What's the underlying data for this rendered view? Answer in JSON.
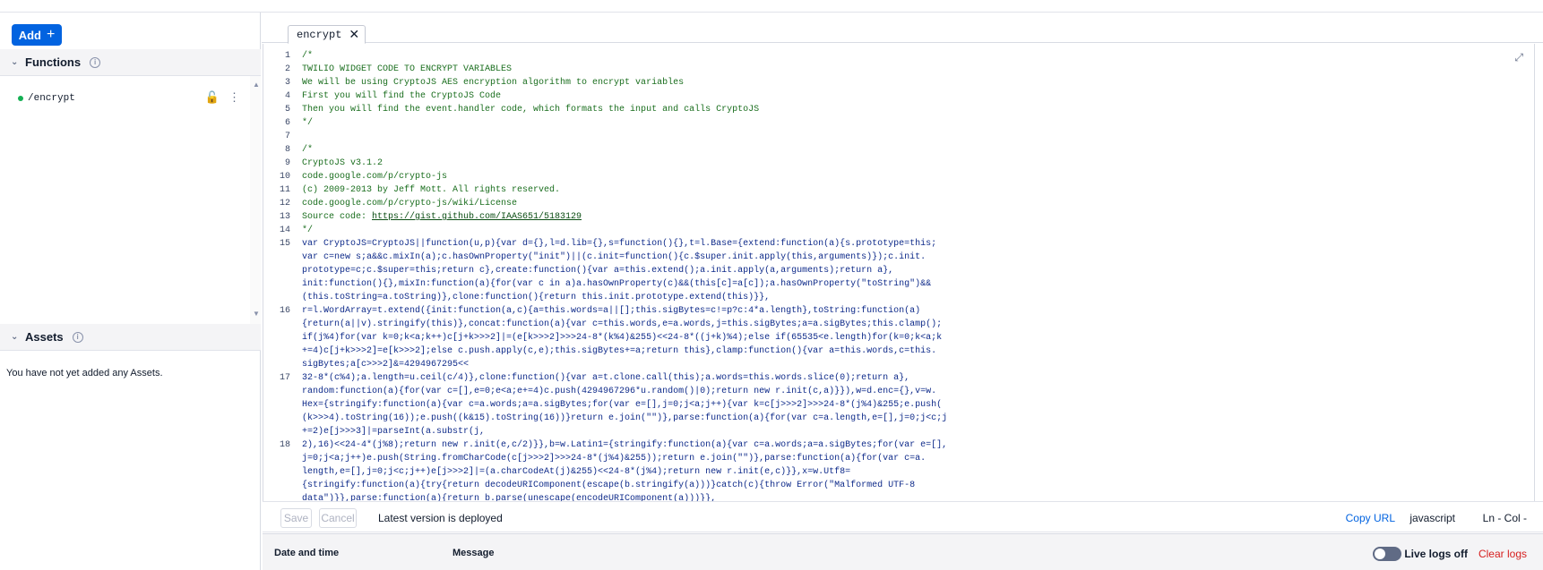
{
  "sidebar": {
    "add_label": "Add",
    "add_icon": "plus-icon",
    "functions": {
      "title": "Functions",
      "items": [
        {
          "path": "/encrypt",
          "status_color": "#14b053"
        }
      ]
    },
    "assets": {
      "title": "Assets",
      "empty_text": "You have not yet added any Assets."
    }
  },
  "editor": {
    "tab_label": "encrypt",
    "lines": [
      {
        "n": "1",
        "kind": "comment",
        "segs": [
          "/*"
        ]
      },
      {
        "n": "2",
        "kind": "comment",
        "segs": [
          "TWILIO WIDGET CODE TO ENCRYPT VARIABLES"
        ]
      },
      {
        "n": "3",
        "kind": "comment",
        "segs": [
          "We will be using CryptoJS AES encryption algorithm to encrypt variables"
        ]
      },
      {
        "n": "4",
        "kind": "comment",
        "segs": [
          "First you will find the CryptoJS Code"
        ]
      },
      {
        "n": "5",
        "kind": "comment",
        "segs": [
          "Then you will find the event.handler code, which formats the input and calls CryptoJS"
        ]
      },
      {
        "n": "6",
        "kind": "comment",
        "segs": [
          "*/"
        ]
      },
      {
        "n": "7",
        "kind": "comment",
        "segs": [
          " "
        ]
      },
      {
        "n": "8",
        "kind": "comment",
        "segs": [
          "/*"
        ]
      },
      {
        "n": "9",
        "kind": "comment",
        "segs": [
          "CryptoJS v3.1.2"
        ]
      },
      {
        "n": "10",
        "kind": "comment",
        "segs": [
          "code.google.com/p/crypto-js"
        ]
      },
      {
        "n": "11",
        "kind": "comment",
        "segs": [
          "(c) 2009-2013 by Jeff Mott. All rights reserved."
        ]
      },
      {
        "n": "12",
        "kind": "comment",
        "segs": [
          "code.google.com/p/crypto-js/wiki/License"
        ]
      },
      {
        "n": "13",
        "kind": "source",
        "segs": [
          "Source code: "
        ],
        "link": "https://gist.github.com/IAAS651/5183129"
      },
      {
        "n": "14",
        "kind": "comment",
        "segs": [
          "*/"
        ]
      },
      {
        "n": "15",
        "kind": "code",
        "segs": [
          "var CryptoJS=CryptoJS||function(u,p){var d={},l=d.lib={},s=function(){},t=l.Base={extend:function(a){s.prototype=this;",
          "var c=new s;a&&c.mixIn(a);c.hasOwnProperty(\"init\")||(c.init=function(){c.$super.init.apply(this,arguments)});c.init.",
          "prototype=c;c.$super=this;return c},create:function(){var a=this.extend();a.init.apply(a,arguments);return a},",
          "init:function(){},mixIn:function(a){for(var c in a)a.hasOwnProperty(c)&&(this[c]=a[c]);a.hasOwnProperty(\"toString\")&&",
          "(this.toString=a.toString)},clone:function(){return this.init.prototype.extend(this)}},"
        ]
      },
      {
        "n": "16",
        "kind": "code",
        "segs": [
          "r=l.WordArray=t.extend({init:function(a,c){a=this.words=a||[];this.sigBytes=c!=p?c:4*a.length},toString:function(a)",
          "{return(a||v).stringify(this)},concat:function(a){var c=this.words,e=a.words,j=this.sigBytes;a=a.sigBytes;this.clamp();",
          "if(j%4)for(var k=0;k<a;k++)c[j+k>>>2]|=(e[k>>>2]>>>24-8*(k%4)&255)<<24-8*((j+k)%4);else if(65535<e.length)for(k=0;k<a;k",
          "+=4)c[j+k>>>2]=e[k>>>2];else c.push.apply(c,e);this.sigBytes+=a;return this},clamp:function(){var a=this.words,c=this.",
          "sigBytes;a[c>>>2]&=4294967295<<"
        ]
      },
      {
        "n": "17",
        "kind": "code",
        "segs": [
          "32-8*(c%4);a.length=u.ceil(c/4)},clone:function(){var a=t.clone.call(this);a.words=this.words.slice(0);return a},",
          "random:function(a){for(var c=[],e=0;e<a;e+=4)c.push(4294967296*u.random()|0);return new r.init(c,a)}}),w=d.enc={},v=w.",
          "Hex={stringify:function(a){var c=a.words;a=a.sigBytes;for(var e=[],j=0;j<a;j++){var k=c[j>>>2]>>>24-8*(j%4)&255;e.push(",
          "(k>>>4).toString(16));e.push((k&15).toString(16))}return e.join(\"\")},parse:function(a){for(var c=a.length,e=[],j=0;j<c;j",
          "+=2)e[j>>>3]|=parseInt(a.substr(j,"
        ]
      },
      {
        "n": "18",
        "kind": "code",
        "segs": [
          "2),16)<<24-4*(j%8);return new r.init(e,c/2)}},b=w.Latin1={stringify:function(a){var c=a.words;a=a.sigBytes;for(var e=[],",
          "j=0;j<a;j++)e.push(String.fromCharCode(c[j>>>2]>>>24-8*(j%4)&255));return e.join(\"\")},parse:function(a){for(var c=a.",
          "length,e=[],j=0;j<c;j++)e[j>>>2]|=(a.charCodeAt(j)&255)<<24-8*(j%4);return new r.init(e,c)}},x=w.Utf8=",
          "{stringify:function(a){try{return decodeURIComponent(escape(b.stringify(a)))}catch(c){throw Error(\"Malformed UTF-8",
          "data\")}},parse:function(a){return b.parse(unescape(encodeURIComponent(a)))}},"
        ]
      }
    ]
  },
  "footer": {
    "save_label": "Save",
    "cancel_label": "Cancel",
    "status": "Latest version is deployed",
    "copy_url": "Copy URL",
    "language": "javascript",
    "cursor": "Ln - Col -"
  },
  "logs": {
    "col_date": "Date and time",
    "col_message": "Message",
    "live_label": "Live logs off",
    "clear_label": "Clear logs"
  }
}
